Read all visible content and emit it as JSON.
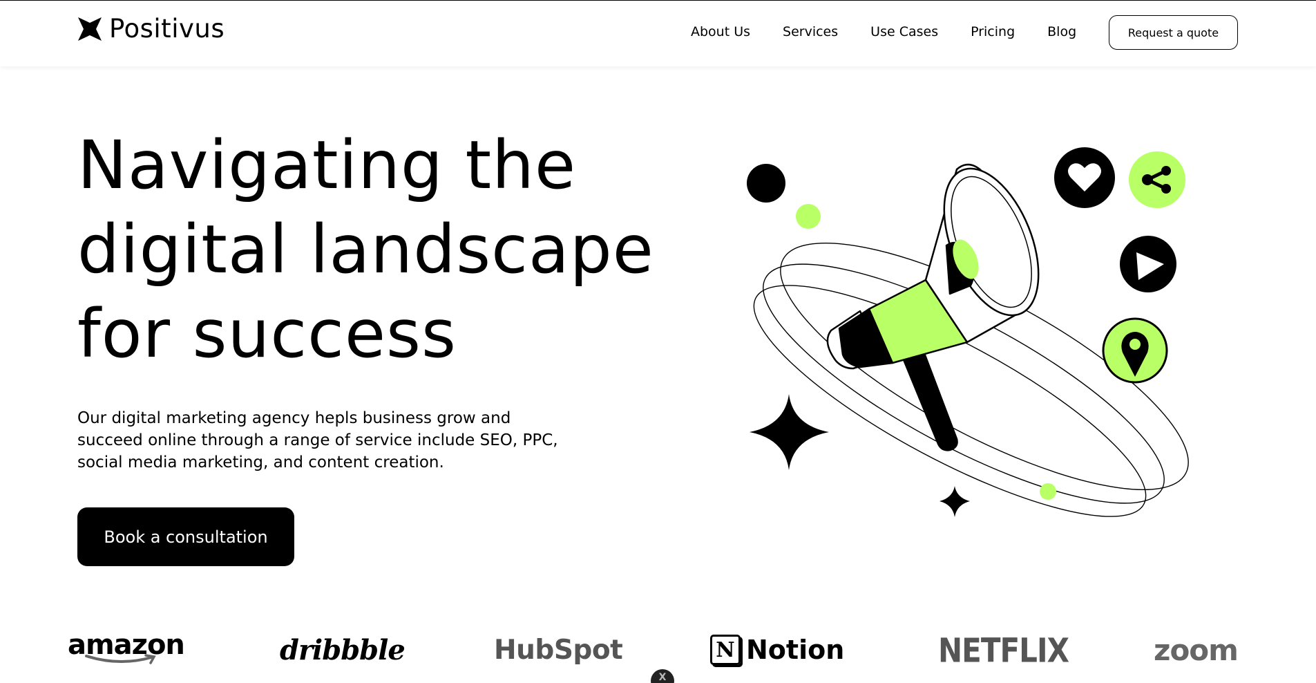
{
  "header": {
    "brand": "Positivus",
    "nav": [
      "About Us",
      "Services",
      "Use Cases",
      "Pricing",
      "Blog"
    ],
    "cta_label": "Request a quote"
  },
  "hero": {
    "title_lines": [
      "Navigating the",
      "digital landscape",
      "for success"
    ],
    "description_lines": [
      "Our digital marketing agency hepls business grow and",
      "succeed online through a range of service include SEO, PPC,",
      "social media marketing, and content creation."
    ],
    "cta_label": "Book a consultation"
  },
  "illustration": {
    "icons": [
      "megaphone-icon",
      "heart-icon",
      "share-icon",
      "play-icon",
      "location-pin-icon",
      "sparkle-star-icon"
    ]
  },
  "clients": {
    "logos": [
      "amazon",
      "dribbble",
      "HubSpot",
      "Notion",
      "NETFLIX",
      "zoom"
    ],
    "notion_mark": "N"
  },
  "scroll_badge_label": "X",
  "colors": {
    "accent": "#B9FF66",
    "dark": "#000000",
    "background": "#FFFFFF"
  }
}
